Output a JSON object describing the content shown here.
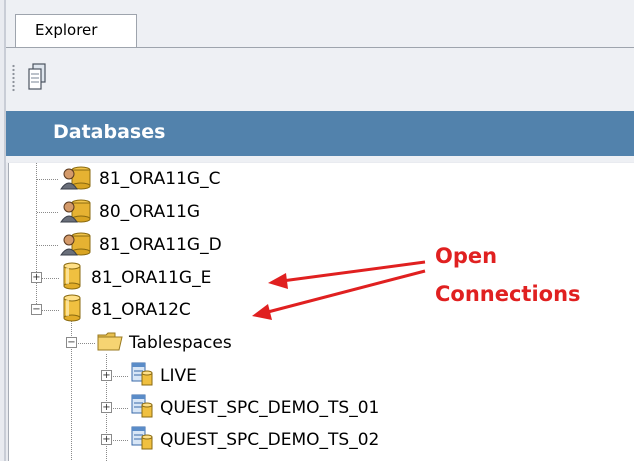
{
  "tab": {
    "label": "Explorer"
  },
  "header": {
    "title": "Databases"
  },
  "tree": {
    "items": [
      {
        "label": "81_ORA11G_C",
        "icon": "database-user-icon"
      },
      {
        "label": "80_ORA11G",
        "icon": "database-user-icon"
      },
      {
        "label": "81_ORA11G_D",
        "icon": "database-user-icon"
      },
      {
        "label": "81_ORA11G_E",
        "icon": "database-cylinder-icon",
        "expander": "+"
      },
      {
        "label": "81_ORA12C",
        "icon": "database-cylinder-icon",
        "expander": "−"
      },
      {
        "label": "Tablespaces",
        "icon": "folder-icon",
        "expander": "−"
      },
      {
        "label": "LIVE",
        "icon": "tablespace-icon",
        "expander": "+"
      },
      {
        "label": "QUEST_SPC_DEMO_TS_01",
        "icon": "tablespace-icon",
        "expander": "+"
      },
      {
        "label": "QUEST_SPC_DEMO_TS_02",
        "icon": "tablespace-icon",
        "expander": "+"
      }
    ]
  },
  "annotation": {
    "line1": "Open",
    "line2": "Connections",
    "color": "#e02020"
  },
  "colors": {
    "header_bg": "#5282ac",
    "chrome_bg": "#eef0f4"
  }
}
